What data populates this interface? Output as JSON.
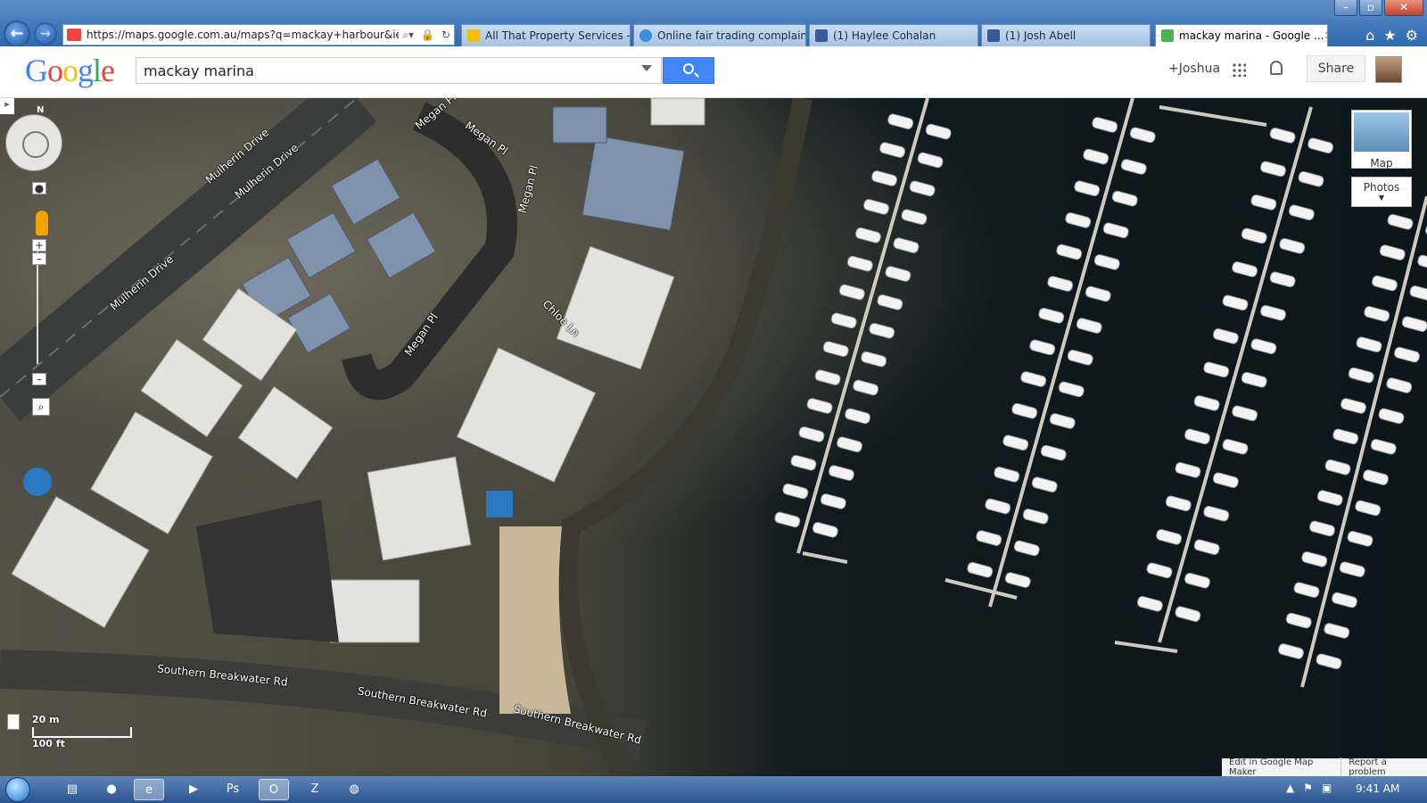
{
  "browser": {
    "address_url": "https://maps.google.com.au/maps?q=mackay+harbour&ie=UTF",
    "tabs": [
      {
        "label": "All That Property Services - Cl..."
      },
      {
        "label": "Online fair trading complaint ..."
      },
      {
        "label": "(1) Haylee Cohalan"
      },
      {
        "label": "(1) Josh Abell"
      },
      {
        "label": "mackay marina - Google ..."
      }
    ]
  },
  "gbar": {
    "logo": "Google",
    "search_value": "mackay marina",
    "user": "+Joshua",
    "share_label": "Share"
  },
  "map": {
    "compass_n": "N",
    "street_labels": [
      "Mulherin Drive",
      "Mulherin Drive",
      "Mulherin Drive",
      "Megan Pl",
      "Megan Pl",
      "Megan Pl",
      "Megan Pl",
      "Chloe Ln",
      "Southern Breakwater Rd",
      "Southern Breakwater Rd",
      "Southern Breakwater Rd"
    ],
    "map_type_label": "Map",
    "photos_label": "Photos",
    "scale_metric": "20 m",
    "scale_imperial": "100 ft",
    "footer_left": "Edit in Google Map Maker",
    "footer_right": "Report a problem"
  },
  "taskbar": {
    "clock": "9:41 AM"
  }
}
